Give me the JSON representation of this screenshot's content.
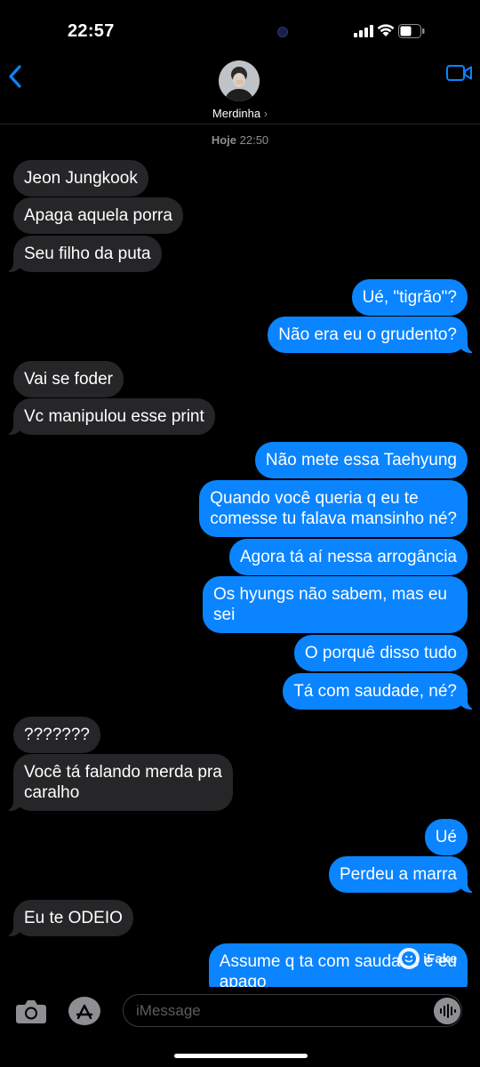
{
  "status_bar": {
    "time": "22:57"
  },
  "header": {
    "contact_name": "Merdinha",
    "chevron": "›"
  },
  "thread": {
    "date_label": "Hoje",
    "date_time": "22:50",
    "messages": [
      {
        "from": "them",
        "text": "Jeon Jungkook"
      },
      {
        "from": "them",
        "text": "Apaga aquela porra"
      },
      {
        "from": "them",
        "text": "Seu filho da puta"
      },
      {
        "from": "me",
        "text": "Ué, \"tigrão\"?"
      },
      {
        "from": "me",
        "text": "Não era eu o grudento?"
      },
      {
        "from": "them",
        "text": "Vai se foder"
      },
      {
        "from": "them",
        "text": "Vc manipulou esse print"
      },
      {
        "from": "me",
        "text": "Não mete essa Taehyung"
      },
      {
        "from": "me",
        "text": "Quando você queria q eu te\ncomesse tu falava mansinho né?"
      },
      {
        "from": "me",
        "text": "Agora tá aí nessa arrogância"
      },
      {
        "from": "me",
        "text": "Os hyungs não sabem, mas eu\nsei"
      },
      {
        "from": "me",
        "text": "O porquê disso tudo"
      },
      {
        "from": "me",
        "text": "Tá com saudade, né?"
      },
      {
        "from": "them",
        "text": "???????"
      },
      {
        "from": "them",
        "text": "Você tá falando merda pra\ncaralho"
      },
      {
        "from": "me",
        "text": "Ué"
      },
      {
        "from": "me",
        "text": "Perdeu a marra"
      },
      {
        "from": "them",
        "text": "Eu te ODEIO"
      },
      {
        "from": "me",
        "text": "Assume q ta com saudade e eu\napago"
      }
    ]
  },
  "watermark": {
    "text": "iFake"
  },
  "composer": {
    "placeholder": "iMessage"
  },
  "colors": {
    "outgoing": "#0a84ff",
    "incoming": "#262628",
    "accent": "#0a84ff"
  },
  "icons": [
    "back-chevron-icon",
    "facetime-video-icon",
    "camera-icon",
    "app-store-icon",
    "audio-waveform-icon",
    "signal-icon",
    "wifi-icon",
    "battery-icon"
  ]
}
